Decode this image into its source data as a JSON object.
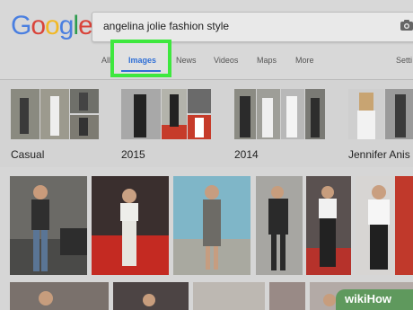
{
  "logo": {
    "letters": [
      "G",
      "o",
      "o",
      "g",
      "l",
      "e"
    ],
    "colors": [
      "#4a7fe0",
      "#d9443a",
      "#f2b824",
      "#4a7fe0",
      "#2e9b4e",
      "#d9443a"
    ]
  },
  "search": {
    "query": "angelina jolie fashion style"
  },
  "tabs": {
    "all": "All",
    "images": "Images",
    "news": "News",
    "videos": "Videos",
    "maps": "Maps",
    "more": "More",
    "settings": "Setti"
  },
  "filters": [
    {
      "label": "Casual"
    },
    {
      "label": "2015"
    },
    {
      "label": "2014"
    },
    {
      "label": "Jennifer Anis"
    }
  ],
  "watermark": "wikiHow",
  "colors": {
    "accent": "#2f6fd6",
    "highlight": "#3ee83e"
  }
}
